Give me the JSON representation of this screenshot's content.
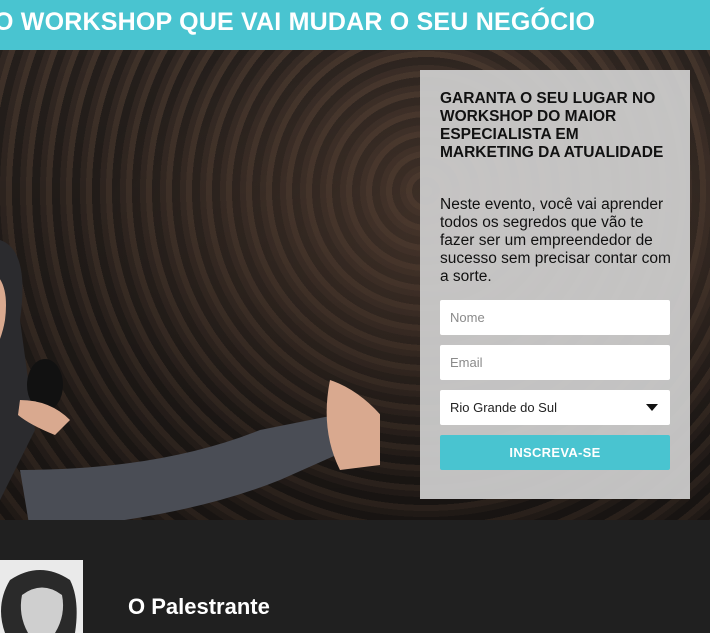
{
  "header": {
    "title": "O WORKSHOP QUE VAI MUDAR O SEU NEGÓCIO"
  },
  "form": {
    "heading": "GARANTA O SEU LUGAR NO WORKSHOP DO MAIOR ESPECIALISTA EM MARKETING DA ATUALIDADE",
    "description": "Neste evento, você vai aprender todos os segredos que vão te fazer ser um empreendedor de sucesso sem precisar contar com a sorte.",
    "name_placeholder": "Nome",
    "email_placeholder": "Email",
    "state_selected": "Rio Grande do Sul",
    "submit_label": "INSCREVA-SE"
  },
  "speaker_section": {
    "title": "O Palestrante"
  },
  "colors": {
    "accent": "#49c4d0",
    "dark": "#202020",
    "card": "#d0d0d0"
  }
}
